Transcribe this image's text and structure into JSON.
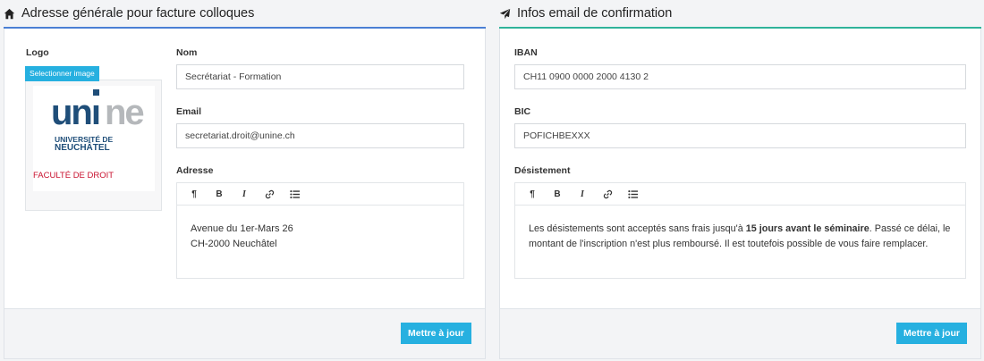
{
  "left": {
    "title": "Adresse générale pour facture colloques",
    "logo_label": "Logo",
    "select_image": "Selectionner image",
    "logo": {
      "text": "unine",
      "uni_line1": "UNIVERSITÉ DE",
      "uni_line2": "NEUCHÂTEL",
      "faculty": "FACULTÉ DE DROIT"
    },
    "nom_label": "Nom",
    "nom_value": "Secrétariat - Formation",
    "email_label": "Email",
    "email_value": "secretariat.droit@unine.ch",
    "adresse_label": "Adresse",
    "adresse_line1": "Avenue du 1er-Mars 26",
    "adresse_line2": "CH-2000 Neuchâtel",
    "update": "Mettre à jour"
  },
  "right": {
    "title": "Infos email de confirmation",
    "iban_label": "IBAN",
    "iban_value": "CH11 0900 0000 2000 4130 2",
    "bic_label": "BIC",
    "bic_value": "POFICHBEXXX",
    "desist_label": "Désistement",
    "desist_part1": "Les désistements sont acceptés sans frais jusqu'à ",
    "desist_bold": "15 jours avant le séminaire",
    "desist_part2": ". Passé ce délai, le montant de l'inscription n'est plus remboursé. Il est toutefois possible de vous faire remplacer.",
    "update": "Mettre à jour"
  },
  "toolbar": {
    "paragraph": "¶",
    "bold": "B",
    "italic": "I"
  },
  "colors": {
    "left_accent": "#4a7fd4",
    "right_accent": "#2fb39a",
    "button": "#26b0e0"
  }
}
